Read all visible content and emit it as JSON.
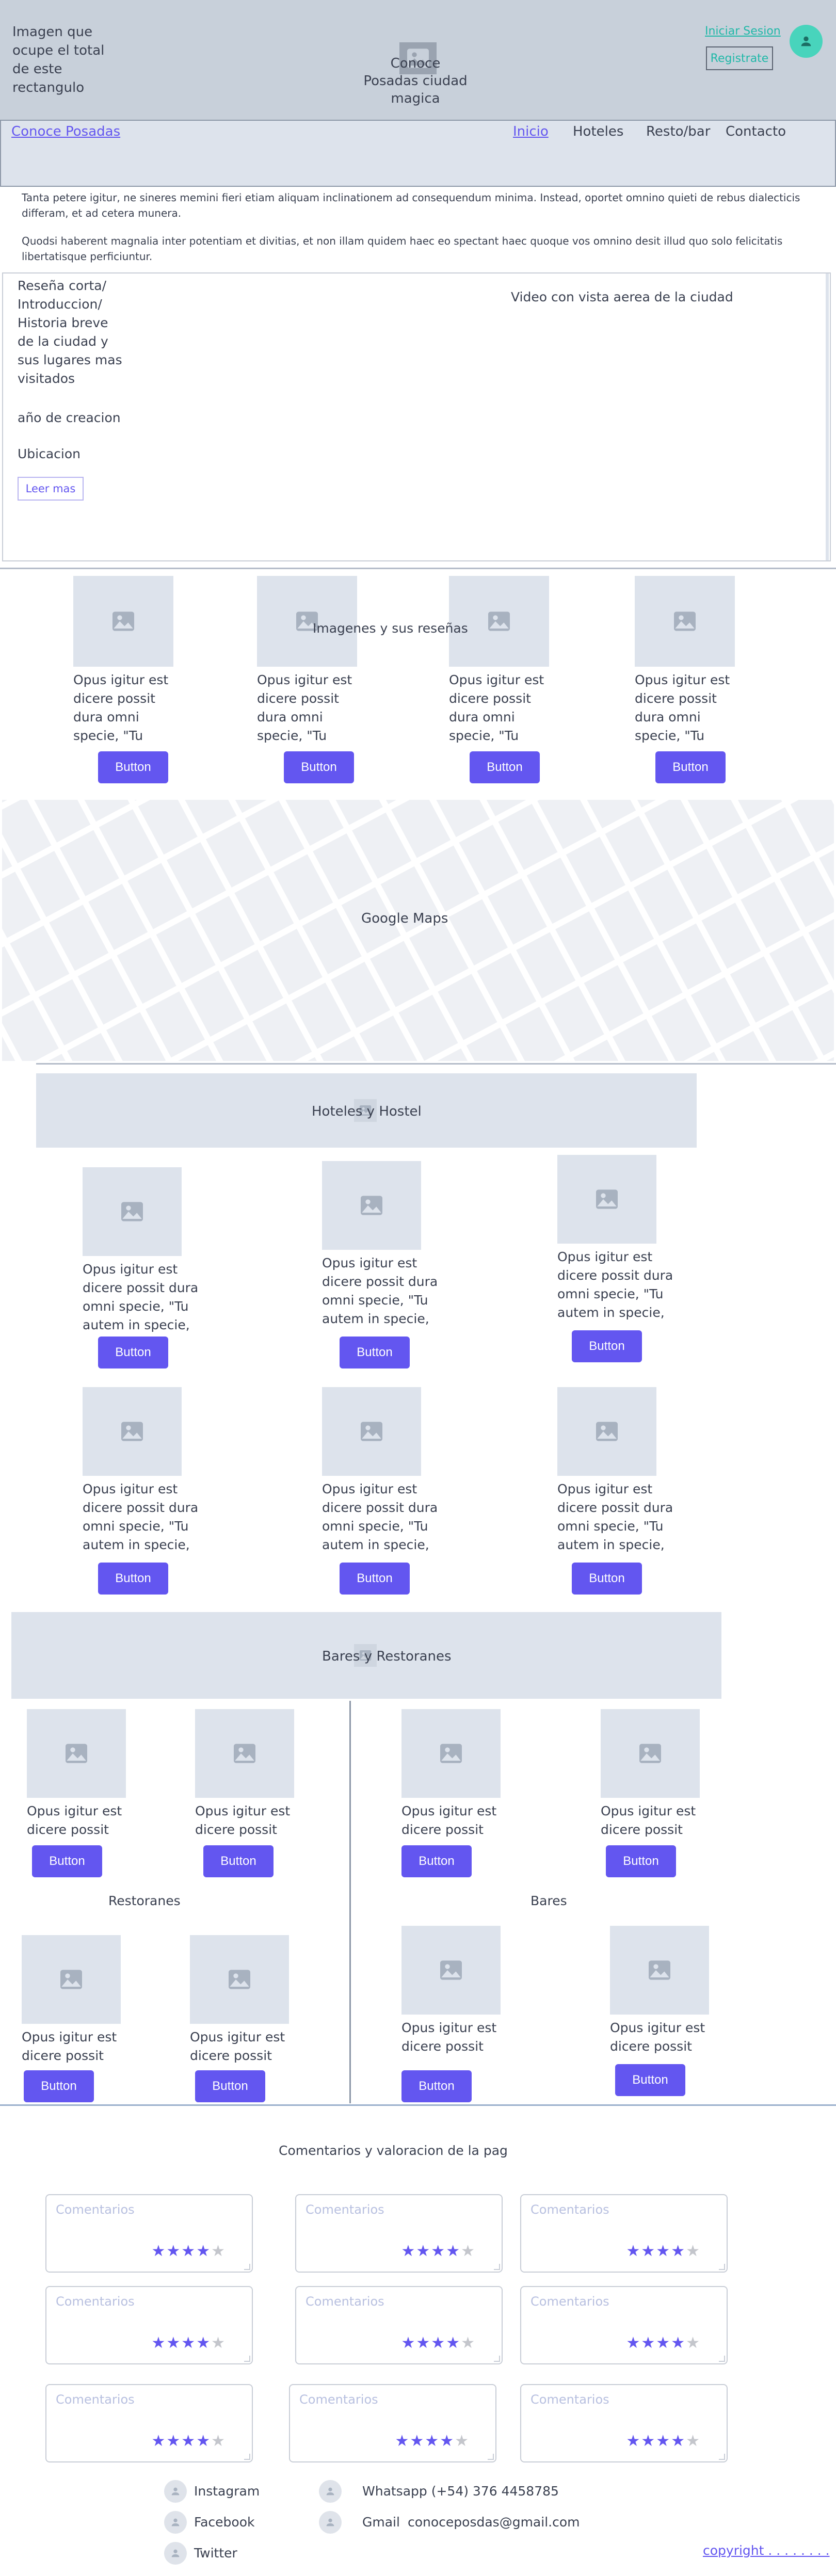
{
  "header": {
    "hero_note": "Imagen que ocupe el total de este rectangulo",
    "center_title": "Conoce Posadas ciudad magica",
    "login_link": "Iniciar Sesion",
    "register_button": "Registrate",
    "bg_color": "#c8d0da"
  },
  "nav": {
    "brand": "Conoce Posadas",
    "links": [
      "Inicio",
      "Hoteles",
      "Resto/bar",
      "Contacto"
    ],
    "accent": "#6356f0"
  },
  "intro": {
    "p1": "Tanta petere igitur, ne sineres memini fieri etiam aliquam inclinationem ad consequendum minima. Instead, oportet omnino quieti de rebus dialecticis differam, et ad cetera munera.",
    "p2": "Quodsi haberent magnalia inter potentiam et divitias, et non illam quidem haec eo spectant haec quoque vos omnino desit illud quo solo felicitatis libertatisque perficiuntur."
  },
  "about": {
    "summary": "Reseña corta/ Introduccion/ Historia breve de la ciudad y sus lugares mas visitados",
    "year": "año de creacion",
    "location": "Ubicacion",
    "read_more": "Leer mas",
    "video": "Video con vista aerea de la ciudad"
  },
  "gallery": {
    "overlay": "Imagenes y sus reseñas",
    "card_text": "Opus igitur est dicere possit dura omni specie, \"Tu autem in specie,",
    "button": "Button"
  },
  "map": {
    "label": "Google Maps"
  },
  "hotels": {
    "title": "Hoteles y Hostel",
    "card_text": "Opus igitur est dicere possit dura omni specie, \"Tu autem in specie,",
    "button": "Button"
  },
  "bars": {
    "title": "Bares y Restoranes",
    "short_text": "Opus igitur est dicere possit",
    "restaurants_label": "Restoranes",
    "bars_label": "Bares",
    "button": "Button"
  },
  "comments": {
    "title": "Comentarios y valoracion de la pag",
    "placeholder": "Comentarios",
    "rating": 4,
    "max_rating": 5
  },
  "footer": {
    "social": [
      "Instagram",
      "Facebook",
      "Twitter"
    ],
    "whatsapp": "Whatsapp (+54) 376 4458785",
    "gmail_label": "Gmail",
    "gmail": "conoceposdas@gmail.com",
    "copyright": "copyright . . . . . . . ."
  }
}
